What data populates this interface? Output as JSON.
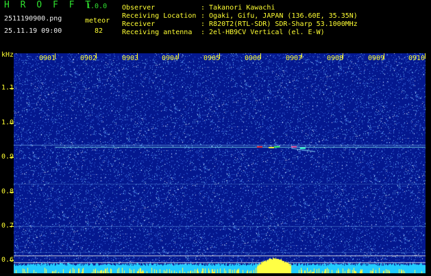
{
  "app": {
    "name": "H R O F F T",
    "version": "1.0.0"
  },
  "file": {
    "filename": "2511190900.png",
    "datetime": "25.11.19 09:00"
  },
  "event": {
    "label": "meteor",
    "count": "82"
  },
  "info": [
    {
      "label": "Observer",
      "value": ": Takanori Kawachi"
    },
    {
      "label": "Receiving Location",
      "value": ": Ogaki, Gifu, JAPAN (136.60E, 35.35N)"
    },
    {
      "label": "Receiver",
      "value": ": R820T2(RTL-SDR) SDR-Sharp 53.1000MHz"
    },
    {
      "label": "Receiving antenna",
      "value": ": 2el-HB9CV Vertical (el. E-W)"
    }
  ],
  "axis": {
    "y_unit": "kHz",
    "y_ticks": [
      "1.1",
      "1.0",
      "0.9",
      "0.8",
      "0.7",
      "0.6"
    ],
    "x_ticks": [
      "0901",
      "0902",
      "0903",
      "0904",
      "0905",
      "0906",
      "0907",
      "0908",
      "0909",
      "0910"
    ]
  },
  "colors": {
    "background": "#04188f",
    "label": "#ffff33",
    "title": "#2fe02f",
    "text": "#f2f2f2"
  }
}
